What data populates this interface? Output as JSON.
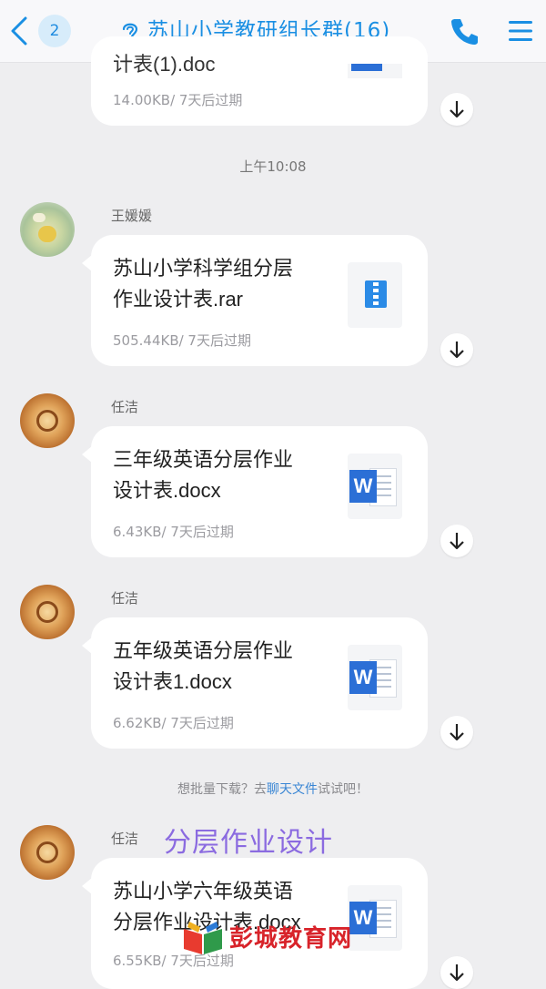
{
  "header": {
    "unread_count": "2",
    "title": "苏山小学教研组长群(16)"
  },
  "messages": [
    {
      "id": "partial",
      "file_name": "计表(1).doc",
      "meta": "14.00KB/ 7天后过期",
      "file_type": "doc"
    },
    {
      "time_divider": "上午10:08"
    },
    {
      "sender": "王媛媛",
      "file_name_line1": "苏山小学科学组分层",
      "file_name_line2": "作业设计表.rar",
      "meta": "505.44KB/ 7天后过期",
      "file_type": "rar"
    },
    {
      "sender": "任洁",
      "file_name_line1": "三年级英语分层作业",
      "file_name_line2": "设计表.docx",
      "meta": "6.43KB/ 7天后过期",
      "file_type": "docx"
    },
    {
      "sender": "任洁",
      "file_name_line1": "五年级英语分层作业",
      "file_name_line2": "设计表1.docx",
      "meta": "6.62KB/ 7天后过期",
      "file_type": "docx"
    },
    {
      "hint_prefix": "想批量下载？去",
      "hint_link": "聊天文件",
      "hint_suffix": "试试吧！"
    },
    {
      "sender": "任洁",
      "file_name_line1": "苏山小学六年级英语",
      "file_name_line2": "分层作业设计表.docx",
      "meta": "6.55KB/ 7天后过期",
      "file_type": "docx"
    }
  ],
  "overlay_caption": "分层作业设计",
  "watermark": "彭城教育网",
  "colors": {
    "accent": "#1a8fe3",
    "word_blue": "#2b6fd6",
    "caption_purple": "#8b6be0",
    "watermark_red": "#d8232a"
  },
  "icons": [
    "back-icon",
    "ear-icon",
    "phone-icon",
    "menu-icon",
    "download-icon",
    "word-file-icon",
    "archive-file-icon"
  ]
}
